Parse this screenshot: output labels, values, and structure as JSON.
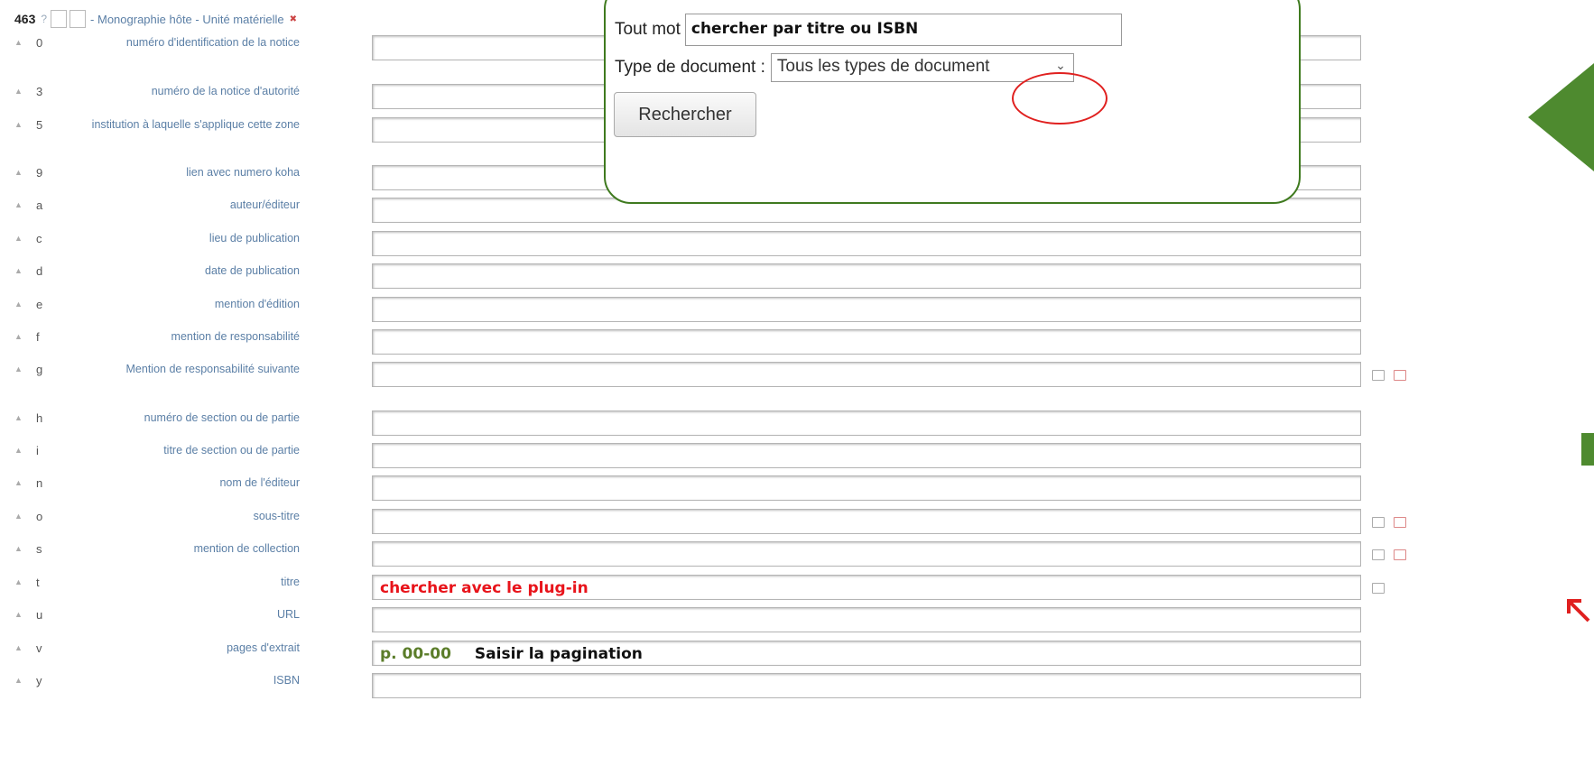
{
  "header": {
    "tag": "463",
    "help": "?",
    "description": "- Monographie hôte - Unité matérielle",
    "delete_mark": "✖"
  },
  "subfields": [
    {
      "code": "0",
      "label": "numéro d'identification de la notice",
      "value": "",
      "icons": []
    },
    {
      "code": "3",
      "label": "numéro de la notice d'autorité",
      "value": "",
      "icons": []
    },
    {
      "code": "5",
      "label": "institution à laquelle s'applique cette zone",
      "value": "",
      "icons": []
    },
    {
      "code": "9",
      "label": "lien avec numero koha",
      "value": "",
      "icons": []
    },
    {
      "code": "a",
      "label": "auteur/éditeur",
      "value": "",
      "icons": []
    },
    {
      "code": "c",
      "label": "lieu de publication",
      "value": "",
      "icons": []
    },
    {
      "code": "d",
      "label": "date de publication",
      "value": "",
      "icons": []
    },
    {
      "code": "e",
      "label": "mention d'édition",
      "value": "",
      "icons": []
    },
    {
      "code": "f",
      "label": "mention de responsabilité",
      "value": "",
      "icons": []
    },
    {
      "code": "g",
      "label": "Mention de responsabilité suivante",
      "value": "",
      "icons": [
        "clone-icon",
        "delete-icon"
      ]
    },
    {
      "code": "h",
      "label": "numéro de section ou de partie",
      "value": "",
      "icons": []
    },
    {
      "code": "i",
      "label": "titre de section ou de partie",
      "value": "",
      "icons": []
    },
    {
      "code": "n",
      "label": "nom de l'éditeur",
      "value": "",
      "icons": []
    },
    {
      "code": "o",
      "label": "sous-titre",
      "value": "",
      "icons": [
        "clone-icon",
        "delete-icon"
      ]
    },
    {
      "code": "s",
      "label": "mention de collection",
      "value": "",
      "icons": [
        "clone-icon",
        "delete-icon"
      ]
    },
    {
      "code": "t",
      "label": "titre",
      "value": "",
      "icons": [
        "plugin-icon"
      ]
    },
    {
      "code": "u",
      "label": "URL",
      "value": "",
      "icons": []
    },
    {
      "code": "v",
      "label": "pages d'extrait",
      "value": "",
      "icons": []
    },
    {
      "code": "y",
      "label": "ISBN",
      "value": "",
      "icons": []
    }
  ],
  "annotations": {
    "titre_hint": "chercher avec le plug-in",
    "pagination_example": "p. 00-00",
    "pagination_hint": "Saisir la pagination"
  },
  "search_popup": {
    "keyword_label": "Tout mot",
    "keyword_value": "chercher par titre ou ISBN",
    "doctype_label": "Type de document :",
    "doctype_selected": "Tous les types de document",
    "search_button": "Rechercher"
  },
  "colors": {
    "label_blue": "#5b7fa6",
    "annotation_red": "#e8141b",
    "annotation_green": "#5b7d2a",
    "popup_border": "#3f7a1f"
  }
}
